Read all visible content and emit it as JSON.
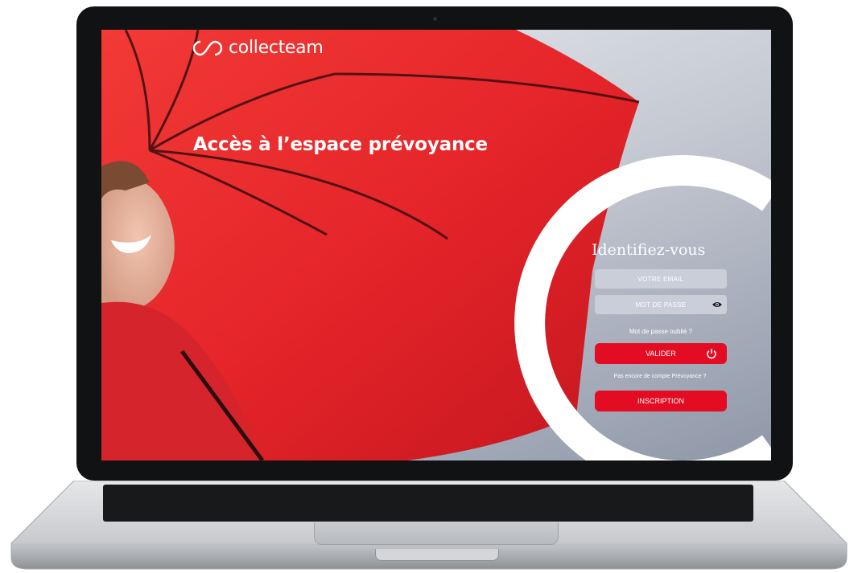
{
  "brand": {
    "name": "collecteam"
  },
  "hero": {
    "headline": "Accès à l’espace prévoyance"
  },
  "login": {
    "title": "Identifiez-vous",
    "email_placeholder": "VOTRE EMAIL",
    "password_placeholder": "MOT DE PASSE",
    "forgot_link": "Mot de passe oublié ?",
    "submit_label": "VALIDER",
    "no_account_text": "Pas encore de compte Prévoyance ?",
    "register_label": "INSCRIPTION"
  },
  "colors": {
    "accent": "#e30c22",
    "umbrella": "#e8242c",
    "field": "#c9ced9"
  },
  "icons": [
    "logo-icon",
    "eye-icon",
    "power-icon"
  ]
}
